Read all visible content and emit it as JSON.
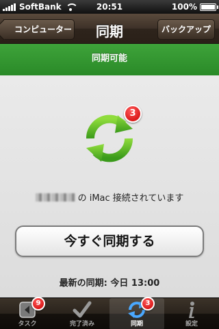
{
  "status_bar": {
    "carrier": "SoftBank",
    "time": "20:51",
    "battery_percent": "100%"
  },
  "nav": {
    "back_label": "コンピューター",
    "title": "同期",
    "right_label": "バックアップ"
  },
  "status_band": "同期可能",
  "main": {
    "sync_badge": "3",
    "connection_text": "の iMac 接続されています",
    "sync_now_label": "今すぐ同期する",
    "last_sync": "最新の同期: 今日 13:00"
  },
  "colors": {
    "accent_green": "#3ea33a",
    "badge_red": "#cc0000",
    "nav_brown": "#3d3128"
  },
  "tabs": [
    {
      "label": "タスク",
      "icon": "task-box-icon",
      "badge": "9",
      "active": false
    },
    {
      "label": "完了済み",
      "icon": "checkmark-icon",
      "badge": "",
      "active": false
    },
    {
      "label": "同期",
      "icon": "sync-icon",
      "badge": "3",
      "active": true
    },
    {
      "label": "設定",
      "icon": "info-icon",
      "badge": "",
      "active": false
    }
  ]
}
